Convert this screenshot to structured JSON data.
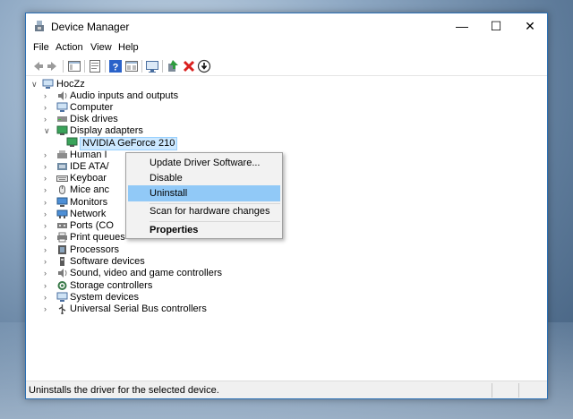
{
  "window": {
    "title": "Device Manager",
    "controls": {
      "minimize": "—",
      "maximize": "☐",
      "close": "✕"
    }
  },
  "menubar": [
    "File",
    "Action",
    "View",
    "Help"
  ],
  "toolbar": {
    "buttons": [
      "back-icon",
      "forward-icon",
      "show-hide-console-tree-icon",
      "properties-icon",
      "help-icon",
      "view-icon",
      "scan-changes-icon",
      "update-driver-icon",
      "uninstall-icon",
      "disable-icon"
    ],
    "colors": {
      "update": "#2e9c3f",
      "uninstall": "#d9201e",
      "help": "#2a62c9"
    }
  },
  "tree": {
    "root": "HocZz",
    "categories": [
      "Audio inputs and outputs",
      "Computer",
      "Disk drives",
      "Display adapters",
      "NVIDIA GeForce 210",
      "Human I",
      "IDE ATA/",
      "Keyboar",
      "Mice anc",
      "Monitors",
      "Network",
      "Ports (CO",
      "Print queues",
      "Processors",
      "Software devices",
      "Sound, video and game controllers",
      "Storage controllers",
      "System devices",
      "Universal Serial Bus controllers"
    ],
    "selected": "NVIDIA GeForce 210"
  },
  "context_menu": {
    "items": [
      "Update Driver Software...",
      "Disable",
      "Uninstall",
      "Scan for hardware changes",
      "Properties"
    ],
    "highlighted": "Uninstall"
  },
  "status": {
    "text": "Uninstalls the driver for the selected device."
  }
}
